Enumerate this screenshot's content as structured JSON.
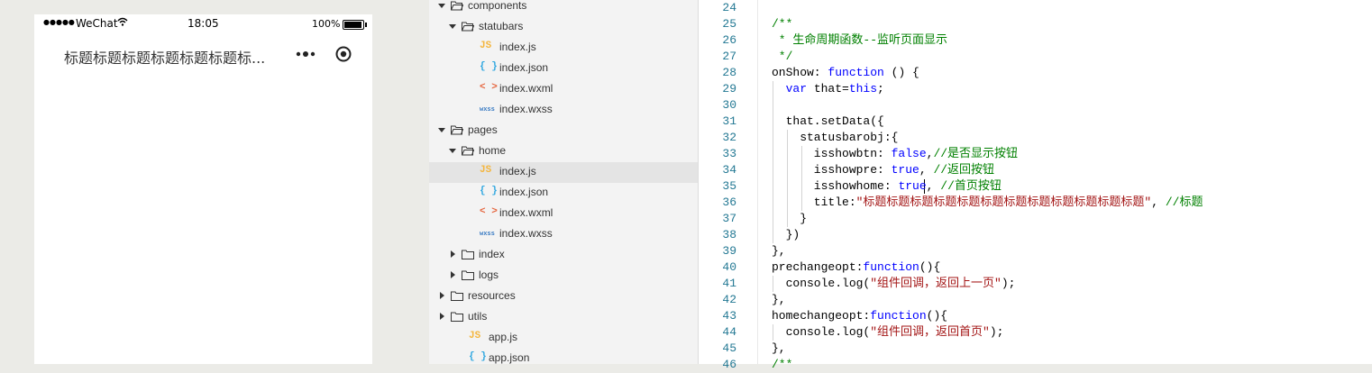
{
  "simulator": {
    "carrier": "WeChat",
    "time": "18:05",
    "battery": "100%",
    "nav_title": "标题标题标题标题标题标题标..."
  },
  "tree": {
    "rows": [
      {
        "label": "components",
        "type": "folder",
        "open": true,
        "level": 0
      },
      {
        "label": "statubars",
        "type": "folder",
        "open": true,
        "level": 1
      },
      {
        "label": "index.js",
        "type": "js",
        "level": 2
      },
      {
        "label": "index.json",
        "type": "json",
        "level": 2
      },
      {
        "label": "index.wxml",
        "type": "wxml",
        "level": 2
      },
      {
        "label": "index.wxss",
        "type": "wxss",
        "level": 2
      },
      {
        "label": "pages",
        "type": "folder",
        "open": true,
        "level": 0
      },
      {
        "label": "home",
        "type": "folder",
        "open": true,
        "level": 1
      },
      {
        "label": "index.js",
        "type": "js",
        "level": 2,
        "selected": true
      },
      {
        "label": "index.json",
        "type": "json",
        "level": 2
      },
      {
        "label": "index.wxml",
        "type": "wxml",
        "level": 2
      },
      {
        "label": "index.wxss",
        "type": "wxss",
        "level": 2
      },
      {
        "label": "index",
        "type": "folder",
        "open": false,
        "level": 1
      },
      {
        "label": "logs",
        "type": "folder",
        "open": false,
        "level": 1
      },
      {
        "label": "resources",
        "type": "folder",
        "open": false,
        "level": 0
      },
      {
        "label": "utils",
        "type": "folder",
        "open": false,
        "level": 0
      },
      {
        "label": "app.js",
        "type": "js",
        "level": 1
      },
      {
        "label": "app.json",
        "type": "json",
        "level": 1
      }
    ],
    "icon_glyphs": {
      "js": "JS",
      "json": "{ }",
      "wxml": "< >",
      "wxss": "wxss"
    }
  },
  "editor": {
    "lines": [
      {
        "n": "24",
        "parts": []
      },
      {
        "n": "25",
        "parts": [
          {
            "t": "/**",
            "c": "c-comment"
          }
        ]
      },
      {
        "n": "26",
        "parts": [
          {
            "t": " * 生命周期函数--监听页面显示",
            "c": "c-comment"
          }
        ]
      },
      {
        "n": "27",
        "parts": [
          {
            "t": " */",
            "c": "c-comment"
          }
        ]
      },
      {
        "n": "28",
        "parts": [
          {
            "t": "onShow: ",
            "c": ""
          },
          {
            "t": "function",
            "c": "c-kw"
          },
          {
            "t": " () {",
            "c": ""
          }
        ]
      },
      {
        "n": "29",
        "parts": [
          {
            "t": "  ",
            "c": ""
          },
          {
            "t": "var",
            "c": "c-kw"
          },
          {
            "t": " that=",
            "c": ""
          },
          {
            "t": "this",
            "c": "c-kw"
          },
          {
            "t": ";",
            "c": ""
          }
        ]
      },
      {
        "n": "30",
        "parts": []
      },
      {
        "n": "31",
        "parts": [
          {
            "t": "  that.setData({",
            "c": ""
          }
        ]
      },
      {
        "n": "32",
        "parts": [
          {
            "t": "    statusbarobj:{",
            "c": ""
          }
        ]
      },
      {
        "n": "33",
        "parts": [
          {
            "t": "      isshowbtn: ",
            "c": ""
          },
          {
            "t": "false",
            "c": "c-kw"
          },
          {
            "t": ",",
            "c": ""
          },
          {
            "t": "//是否显示按钮",
            "c": "c-comment"
          }
        ]
      },
      {
        "n": "34",
        "parts": [
          {
            "t": "      isshowpre: ",
            "c": ""
          },
          {
            "t": "true",
            "c": "c-kw"
          },
          {
            "t": ", ",
            "c": ""
          },
          {
            "t": "//返回按钮",
            "c": "c-comment"
          }
        ]
      },
      {
        "n": "35",
        "parts": [
          {
            "t": "      isshowhome: ",
            "c": ""
          },
          {
            "t": "true",
            "c": "c-kw"
          },
          {
            "t": ", ",
            "c": ""
          },
          {
            "t": "//首页按钮",
            "c": "c-comment"
          }
        ]
      },
      {
        "n": "36",
        "parts": [
          {
            "t": "      title:",
            "c": ""
          },
          {
            "t": "\"标题标题标题标题标题标题标题标题标题标题标题标题\"",
            "c": "c-str"
          },
          {
            "t": ", ",
            "c": ""
          },
          {
            "t": "//标题",
            "c": "c-comment"
          }
        ]
      },
      {
        "n": "37",
        "parts": [
          {
            "t": "    }",
            "c": ""
          }
        ]
      },
      {
        "n": "38",
        "parts": [
          {
            "t": "  })",
            "c": ""
          }
        ]
      },
      {
        "n": "39",
        "parts": [
          {
            "t": "},",
            "c": ""
          }
        ]
      },
      {
        "n": "40",
        "parts": [
          {
            "t": "prechangeopt:",
            "c": ""
          },
          {
            "t": "function",
            "c": "c-kw"
          },
          {
            "t": "(){",
            "c": ""
          }
        ]
      },
      {
        "n": "41",
        "parts": [
          {
            "t": "  console.log(",
            "c": ""
          },
          {
            "t": "\"组件回调，返回上一页\"",
            "c": "c-str"
          },
          {
            "t": ");",
            "c": ""
          }
        ]
      },
      {
        "n": "42",
        "parts": [
          {
            "t": "},",
            "c": ""
          }
        ]
      },
      {
        "n": "43",
        "parts": [
          {
            "t": "homechangeopt:",
            "c": ""
          },
          {
            "t": "function",
            "c": "c-kw"
          },
          {
            "t": "(){",
            "c": ""
          }
        ]
      },
      {
        "n": "44",
        "parts": [
          {
            "t": "  console.log(",
            "c": ""
          },
          {
            "t": "\"组件回调，返回首页\"",
            "c": "c-str"
          },
          {
            "t": ");",
            "c": ""
          }
        ]
      },
      {
        "n": "45",
        "parts": [
          {
            "t": "},",
            "c": ""
          }
        ]
      },
      {
        "n": "46",
        "parts": [
          {
            "t": "/**",
            "c": "c-comment"
          }
        ]
      }
    ]
  }
}
